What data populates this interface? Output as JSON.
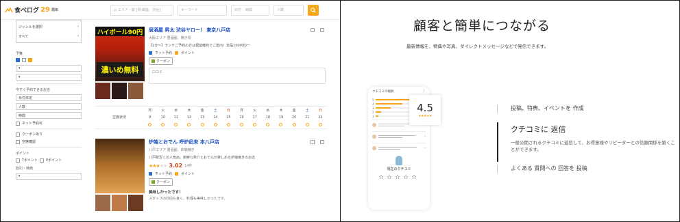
{
  "left": {
    "logo": {
      "name": "食べログ",
      "years": "29",
      "suffix": "周年"
    },
    "search": {
      "placeholder_1": "エリア・駅 [例:銀座、渋谷]",
      "placeholder_2": "キーワード",
      "date": "日付",
      "time": "時間",
      "people": "人数",
      "action": "検索する"
    },
    "sidebar": {
      "genre_label": "ジャンル",
      "genre_options": [
        "ジャンルを選択",
        "すべて"
      ],
      "budget_title": "予算",
      "budget_lunch": "ランチ",
      "budget_dinner": "ディナー",
      "reserve_title": "今すぐ予約できるお店",
      "date_field": "日付未定",
      "people_field": "人数",
      "time_field": "時間",
      "other_cond_1": "その他の条件",
      "cond_online": "ネット予約可",
      "cond_point": "ポイント",
      "point_a": "Tポイント",
      "point_b": "Pポイント",
      "cond_discount": "割引・特典",
      "coupon": "クーポンあり",
      "cond_facility": "空席確認"
    },
    "cards": [
      {
        "banner": "ハイボール90円",
        "big_text": "濃いめ無料",
        "title": "居酒屋 昇太 渋谷ヤロー！ 東京八戸店",
        "sub": "大阪エリア 居酒屋、焼き鳥",
        "desc": "【1分〜】ランチご予約の方は個室確約でご案内！全品100円均一",
        "tag_1": "ネット予約",
        "tag_2": "ポイント",
        "coupon": "クーポン",
        "review_label": "口コミ",
        "calendar_label": "空席状況",
        "days": [
          "月",
          "火",
          "水",
          "木",
          "金",
          "土",
          "日",
          "月",
          "火",
          "水",
          "木",
          "金",
          "土",
          "日"
        ],
        "dates": [
          "9",
          "10",
          "11",
          "12",
          "13",
          "14",
          "15",
          "16",
          "17",
          "18",
          "19",
          "20",
          "21",
          "22"
        ]
      },
      {
        "title": "炉端とおでん 呼炉凪来 本八戸店",
        "sub": "八戸エリア 居酒屋、炉端焼き",
        "desc": "八戸駅近くの人気店。新鮮な魚介とおでんが楽しめる炉端焼きのお店",
        "score": "3.02",
        "review_count": "14件",
        "tag_1": "ネット予約",
        "tag_2": "ポイント",
        "coupon": "クーポン",
        "review_title": "美味しかったです！",
        "review_text": "スタッフの対応も良く、料理も美味しかったです。"
      }
    ]
  },
  "right": {
    "title": "顧客と簡単につながる",
    "subtitle": "最新情報を、特典や写真、ダイレクトメッセージなどで発信できます。",
    "phone": {
      "header": "クチコミの概要",
      "score": "4.5",
      "post_label": "現在のクチコミ"
    },
    "menu": [
      "投稿、特典、イベントを 作成",
      "クチコミに 返信",
      "一般公開されるクチコミに返信して、お得意様やリピーターとの信頼関係を築くことができます。",
      "よくある 質問への 回答を 投稿"
    ]
  }
}
